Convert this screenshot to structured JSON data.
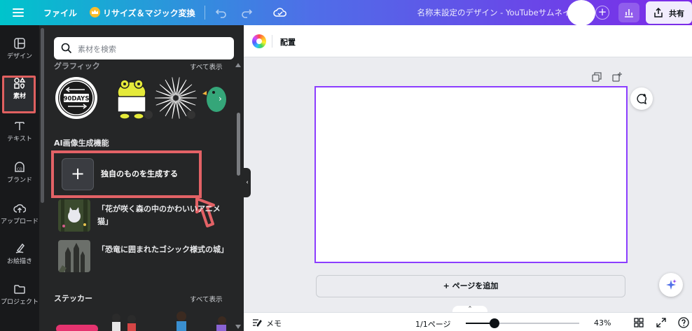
{
  "topbar": {
    "file_label": "ファイル",
    "resize_label": "リサイズ＆マジック変換",
    "design_title": "名称未設定のデザイン - YouTubeサムネイル",
    "share_label": "共有"
  },
  "rail": {
    "items": [
      {
        "label": "デザイン",
        "icon": "layout-icon"
      },
      {
        "label": "素材",
        "icon": "elements-icon"
      },
      {
        "label": "テキスト",
        "icon": "text-icon"
      },
      {
        "label": "ブランド",
        "icon": "brand-icon"
      },
      {
        "label": "アップロード",
        "icon": "upload-icon"
      },
      {
        "label": "お絵描き",
        "icon": "draw-icon"
      },
      {
        "label": "プロジェクト",
        "icon": "folder-icon"
      }
    ]
  },
  "panel": {
    "search_placeholder": "素材を検索",
    "graphics": {
      "title": "グラフィック",
      "see_all": "すべて表示",
      "thumb_text": "90DAYS"
    },
    "ai": {
      "title": "AI画像生成機能",
      "generate_label": "独自のものを生成する",
      "prompts": [
        {
          "text": "「花が咲く森の中のかわいいアニメ猫」"
        },
        {
          "text": "「恐竜に囲まれたゴシック様式の城」"
        }
      ]
    },
    "stickers": {
      "title": "ステッカー",
      "see_all": "すべて表示"
    }
  },
  "context_bar": {
    "position_label": "配置"
  },
  "canvas": {
    "add_page_label": "+ ページを追加"
  },
  "bottom": {
    "notes_label": "メモ",
    "page_count": "1/1ページ",
    "zoom_percent": 43,
    "zoom_label": "43%"
  },
  "colors": {
    "accent": "#8b3dff",
    "highlight": "#e36266",
    "rail_bg": "#18191b",
    "panel_bg": "#252627"
  }
}
